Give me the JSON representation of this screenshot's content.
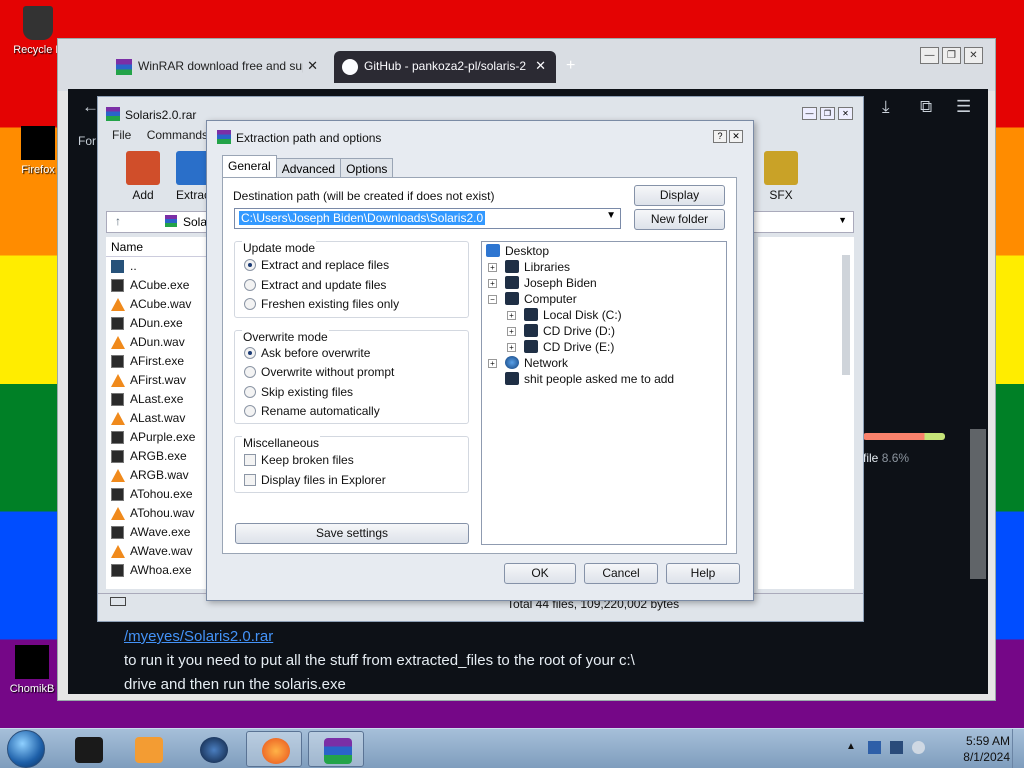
{
  "desktop": {
    "icons": [
      {
        "label": "Recycle B"
      },
      {
        "label": "Firefox"
      },
      {
        "label": "ChomikB"
      }
    ]
  },
  "browser": {
    "tabs": [
      {
        "label": "WinRAR download free and sup",
        "close": "✕"
      },
      {
        "label": "GitHub - pankoza2-pl/solaris-2",
        "close": "✕"
      }
    ],
    "new_tab": "+",
    "window_buttons": [
      "—",
      "❐",
      "✕"
    ],
    "nav": {
      "back": "←",
      "partial_text": "For"
    },
    "page": {
      "link": "/myeyes/Solaris2.0.rar",
      "text": "to run it you need to put all the stuff from extracted_files to the root of your c:\\ drive and then run the solaris.exe",
      "progress_label": "file",
      "progress_value": "8.6%",
      "progress_fraction": 0.75
    }
  },
  "winrar": {
    "title": "Solaris2.0.rar",
    "menu": [
      "File",
      "Commands"
    ],
    "toolbar": [
      {
        "label": "Add",
        "color": "#d04e2a"
      },
      {
        "label": "Extrac",
        "color": "#2a6fc9"
      },
      {
        "label": "SFX",
        "color": "#c9a227"
      }
    ],
    "address": "Sola",
    "list_header": "Name",
    "files": [
      {
        "name": "..",
        "type": "up"
      },
      {
        "name": "ACube.exe",
        "type": "exe"
      },
      {
        "name": "ACube.wav",
        "type": "wav"
      },
      {
        "name": "ADun.exe",
        "type": "exe"
      },
      {
        "name": "ADun.wav",
        "type": "wav"
      },
      {
        "name": "AFirst.exe",
        "type": "exe"
      },
      {
        "name": "AFirst.wav",
        "type": "wav"
      },
      {
        "name": "ALast.exe",
        "type": "exe"
      },
      {
        "name": "ALast.wav",
        "type": "wav"
      },
      {
        "name": "APurple.exe",
        "type": "exe"
      },
      {
        "name": "ARGB.exe",
        "type": "exe"
      },
      {
        "name": "ARGB.wav",
        "type": "wav"
      },
      {
        "name": "ATohou.exe",
        "type": "exe"
      },
      {
        "name": "ATohou.wav",
        "type": "wav"
      },
      {
        "name": "AWave.exe",
        "type": "exe"
      },
      {
        "name": "AWave.wav",
        "type": "wav"
      },
      {
        "name": "AWhoa.exe",
        "type": "exe"
      }
    ],
    "status": "Total 44 files, 109,220,002 bytes"
  },
  "dialog": {
    "title": "Extraction path and options",
    "tabs": [
      "General",
      "Advanced",
      "Options"
    ],
    "dest_label": "Destination path (will be created if does not exist)",
    "dest_value": "C:\\Users\\Joseph Biden\\Downloads\\Solaris2.0",
    "display_btn": "Display",
    "new_folder_btn": "New folder",
    "update_mode": {
      "label": "Update mode",
      "options": [
        "Extract and replace files",
        "Extract and update files",
        "Freshen existing files only"
      ],
      "selected": 0
    },
    "overwrite_mode": {
      "label": "Overwrite mode",
      "options": [
        "Ask before overwrite",
        "Overwrite without prompt",
        "Skip existing files",
        "Rename automatically"
      ],
      "selected": 0
    },
    "misc": {
      "label": "Miscellaneous",
      "options": [
        "Keep broken files",
        "Display files in Explorer"
      ]
    },
    "save_btn": "Save settings",
    "tree": [
      {
        "label": "Desktop",
        "level": 0,
        "icon": "blue"
      },
      {
        "label": "Libraries",
        "level": 1,
        "exp": "+"
      },
      {
        "label": "Joseph Biden",
        "level": 1,
        "exp": "+"
      },
      {
        "label": "Computer",
        "level": 1,
        "exp": "−"
      },
      {
        "label": "Local Disk (C:)",
        "level": 2,
        "exp": "+"
      },
      {
        "label": "CD Drive (D:)",
        "level": 2,
        "exp": "+"
      },
      {
        "label": "CD Drive (E:)",
        "level": 2,
        "exp": "+"
      },
      {
        "label": "Network",
        "level": 1,
        "exp": "+",
        "icon": "globe"
      },
      {
        "label": "shit people asked me to add",
        "level": 1
      }
    ],
    "ok_btn": "OK",
    "cancel_btn": "Cancel",
    "help_btn": "Help",
    "help_icon": "?",
    "close_icon": "✕"
  },
  "taskbar": {
    "time": "5:59 AM",
    "date": "8/1/2024"
  }
}
